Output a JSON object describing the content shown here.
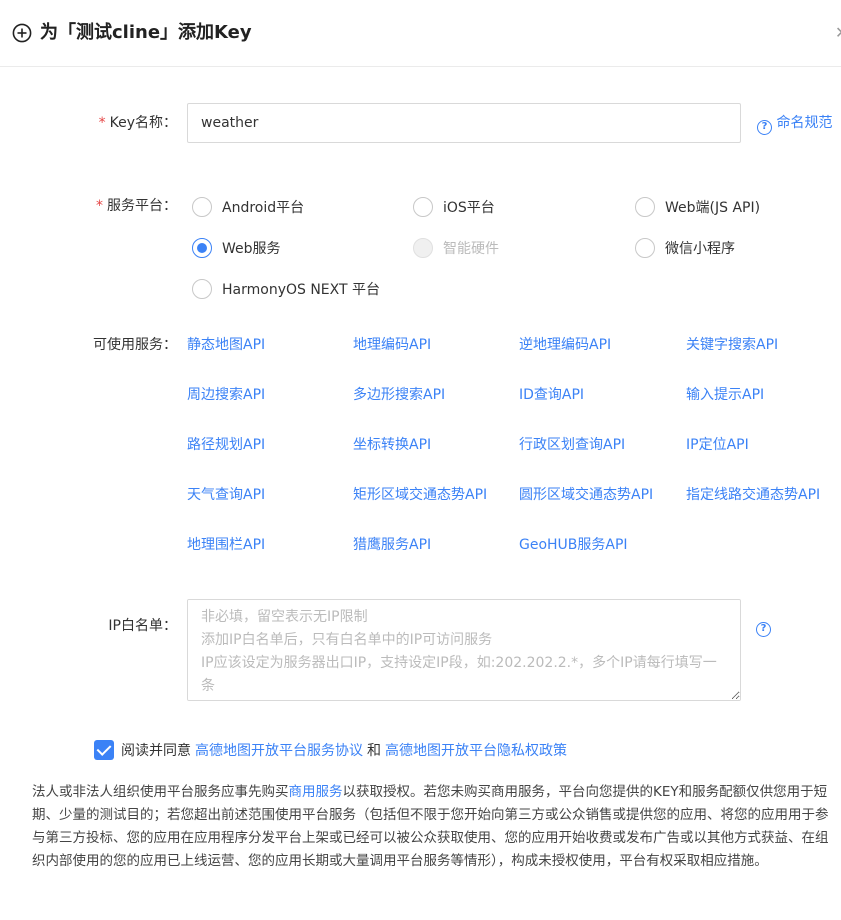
{
  "header": {
    "title": "为「测试cline」添加Key"
  },
  "form": {
    "key_name": {
      "label": "Key名称：",
      "required_mark": "*",
      "value": "weather",
      "help_link": "命名规范"
    },
    "platform": {
      "label": "服务平台：",
      "required_mark": "*",
      "options": [
        {
          "label": "Android平台",
          "checked": false,
          "disabled": false
        },
        {
          "label": "iOS平台",
          "checked": false,
          "disabled": false
        },
        {
          "label": "Web端(JS API)",
          "checked": false,
          "disabled": false
        },
        {
          "label": "Web服务",
          "checked": true,
          "disabled": false
        },
        {
          "label": "智能硬件",
          "checked": false,
          "disabled": true
        },
        {
          "label": "微信小程序",
          "checked": false,
          "disabled": false
        },
        {
          "label": "HarmonyOS NEXT 平台",
          "checked": false,
          "disabled": false
        }
      ]
    },
    "services": {
      "label": "可使用服务：",
      "items": [
        "静态地图API",
        "地理编码API",
        "逆地理编码API",
        "关键字搜索API",
        "周边搜索API",
        "多边形搜索API",
        "ID查询API",
        "输入提示API",
        "路径规划API",
        "坐标转换API",
        "行政区划查询API",
        "IP定位API",
        "天气查询API",
        "矩形区域交通态势API",
        "圆形区域交通态势API",
        "指定线路交通态势API",
        "地理围栏API",
        "猎鹰服务API",
        "GeoHUB服务API"
      ]
    },
    "ip_whitelist": {
      "label": "IP白名单：",
      "value": "",
      "placeholder": "非必填，留空表示无IP限制\n添加IP白名单后，只有白名单中的IP可访问服务\nIP应该设定为服务器出口IP，支持设定IP段，如:202.202.2.*，多个IP请每行填写一条"
    },
    "agreement": {
      "checked": true,
      "prefix": "阅读并同意",
      "link1": "高德地图开放平台服务协议",
      "and": "和",
      "link2": "高德地图开放平台隐私权政策"
    }
  },
  "notice": {
    "part1": "法人或非法人组织使用平台服务应事先购买",
    "link": "商用服务",
    "part2": "以获取授权。若您未购买商用服务，平台向您提供的KEY和服务配额仅供您用于短期、少量的测试目的；若您超出前述范围使用平台服务（包括但不限于您开始向第三方或公众销售或提供您的应用、将您的应用用于参与第三方投标、您的应用在应用程序分发平台上架或已经可以被公众获取使用、您的应用开始收费或发布广告或以其他方式获益、在组织内部使用的您的应用已上线运营、您的应用长期或大量调用平台服务等情形），构成未授权使用，平台有权采取相应措施。"
  },
  "colors": {
    "accent": "#3b82f6",
    "required": "#e54545"
  }
}
